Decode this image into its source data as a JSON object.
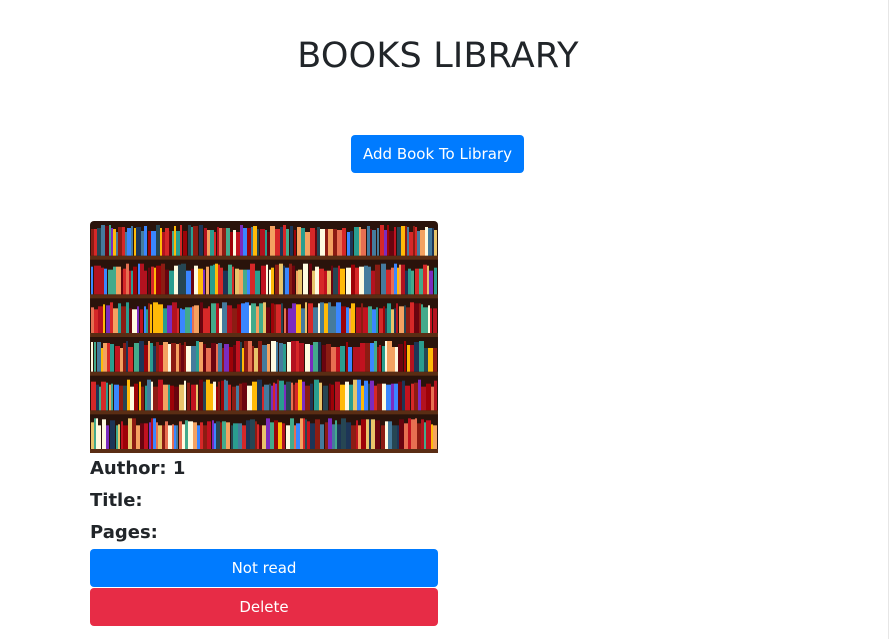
{
  "header": {
    "title": "BOOKS LIBRARY"
  },
  "toolbar": {
    "add_book_label": "Add Book To Library"
  },
  "books": [
    {
      "image_icon": "bookshelf-image",
      "author_label": "Author:",
      "author_value": "1",
      "title_label": "Title:",
      "title_value": "",
      "pages_label": "Pages:",
      "pages_value": "",
      "status_label": "Not read",
      "delete_label": "Delete"
    }
  ],
  "colors": {
    "primary": "#007bff",
    "danger": "#e72c46",
    "text": "#212529"
  }
}
